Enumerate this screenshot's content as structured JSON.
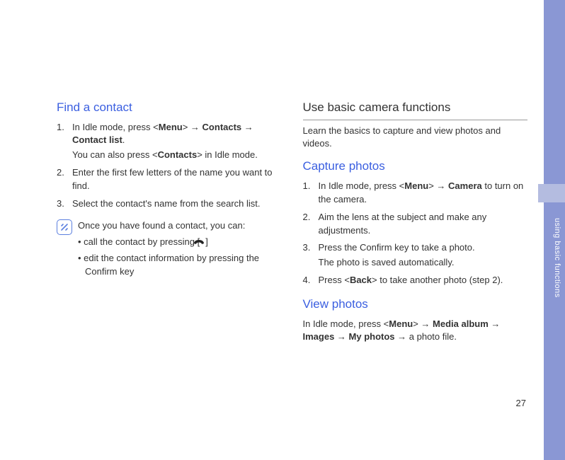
{
  "sidebar": {
    "label": "using basic functions"
  },
  "pageNumber": "27",
  "left": {
    "heading": "Find a contact",
    "step1_a": "In Idle mode, press <",
    "step1_b": "Menu",
    "step1_c": "> → ",
    "step1_d": "Contacts",
    "step1_e": " → ",
    "step1_f": "Contact list",
    "step1_g": ".",
    "step1_sub_a": "You can also press <",
    "step1_sub_b": "Contacts",
    "step1_sub_c": "> in Idle mode.",
    "step2": "Enter the first few letters of the name you want to find.",
    "step3": "Select the contact's name from the search list.",
    "note_intro": "Once you have found a contact, you can:",
    "note_b1_a": "• call the contact by pressing [",
    "note_b1_b": "]",
    "note_b2": "• edit the contact information by pressing the Confirm key"
  },
  "right": {
    "heading1": "Use basic camera functions",
    "intro": "Learn the basics to capture and view photos and videos.",
    "heading2": "Capture photos",
    "cap_s1_a": "In Idle mode, press <",
    "cap_s1_b": "Menu",
    "cap_s1_c": "> → ",
    "cap_s1_d": "Camera",
    "cap_s1_e": " to turn on the camera.",
    "cap_s2": "Aim the lens at the subject and make any adjustments.",
    "cap_s3": "Press the Confirm key to take a photo.",
    "cap_s3_sub": "The photo is saved automatically.",
    "cap_s4_a": "Press <",
    "cap_s4_b": "Back",
    "cap_s4_c": "> to take another photo (step 2).",
    "heading3": "View photos",
    "view_a": "In Idle mode, press <",
    "view_b": "Menu",
    "view_c": "> → ",
    "view_d": "Media album",
    "view_e": " → ",
    "view_f": "Images",
    "view_g": " → ",
    "view_h": "My photos",
    "view_i": " → a photo file."
  }
}
